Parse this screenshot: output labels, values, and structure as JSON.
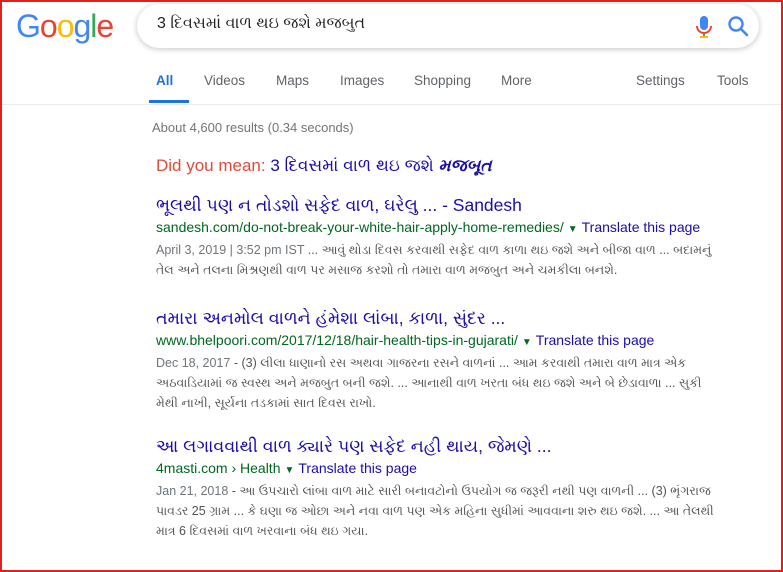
{
  "logo": {
    "letters": [
      "G",
      "o",
      "o",
      "g",
      "l",
      "e"
    ],
    "colors": [
      "#4285F4",
      "#EA4335",
      "#FBBC05",
      "#4285F4",
      "#34A853",
      "#EA4335"
    ]
  },
  "search": {
    "query": "3 દિવસમાં વાળ થઇ જશે મજબુત"
  },
  "tabs": {
    "all": "All",
    "videos": "Videos",
    "maps": "Maps",
    "images": "Images",
    "shopping": "Shopping",
    "more": "More",
    "settings": "Settings",
    "tools": "Tools"
  },
  "stats": "About 4,600 results (0.34 seconds)",
  "did_you_mean": {
    "label": "Did you mean:",
    "plain": "3 દિવસમાં વાળ થઇ જશે",
    "bold": "મજબૂત"
  },
  "results": [
    {
      "title": "ભૂલથી પણ ન તોડશો સફેદ વાળ, ઘરેલુ ... - Sandesh",
      "url": "sandesh.com/do-not-break-your-white-hair-apply-home-remedies/",
      "translate": "Translate this page",
      "date": "April 3, 2019 | 3:52 pm IST",
      "snippet_line1": " ... આવું થોડા દિવસ કરવાથી સફેદ વાળ કાળા થઇ જશે અને બીજા વાળ ... બદામનું",
      "snippet_line2": "તેલ અને તલના મિશ્રણથી વાળ પર મસાજ કરશો તો તમારા વાળ મજબુત અને ચમકીલા બનશે."
    },
    {
      "title": "તમારા અનમોલ વાળને હંમેશા લાંબા, કાળા, સુંદર ...",
      "url": "www.bhelpoori.com/2017/12/18/hair-health-tips-in-gujarati/",
      "translate": "Translate this page",
      "date": "Dec 18, 2017",
      "snippet_line1": " - (3) લીલા ધાણાનો રસ અથવા ગાજરના રસને વાળનાં ... આમ કરવાથી તમારા વાળ માત્ર એક",
      "snippet_line2": "અઠવાડિયામાં જ સ્વસ્થ અને મજબુત બની જશે. ... આનાથી વાળ ખરતા બંધ થઇ જશે અને બે છેડાવાળા ... સુકી",
      "snippet_line3": "મેથી નાખી, સૂર્યના તડકામાં સાત દિવસ રાખો."
    },
    {
      "title": "આ લગાવવાથી વાળ ક્યારે પણ સફેદ નહી થાય, જેમણે ...",
      "url": "4masti.com › Health",
      "translate": "Translate this page",
      "date": "Jan 21, 2018",
      "snippet_line1": " - આ ઉપચારો લાંબા વાળ માટે સારી બનાવટોનો ઉપયોગ જ જરૂરી નથી પણ વાળની ... (3) ભૃંગરાજ",
      "snippet_line2": "પાવડર 25 ગ્રામ ... કે ઘણા જ ઓછા અને નવા વાળ પણ એક મહિના સુધીમાં આવવાના શરુ થઇ જશે. ... આ તેલથી",
      "snippet_line3": "માત્ર 6 દિવસમાં વાળ ખરવાના બંધ થઇ ગયા."
    }
  ]
}
